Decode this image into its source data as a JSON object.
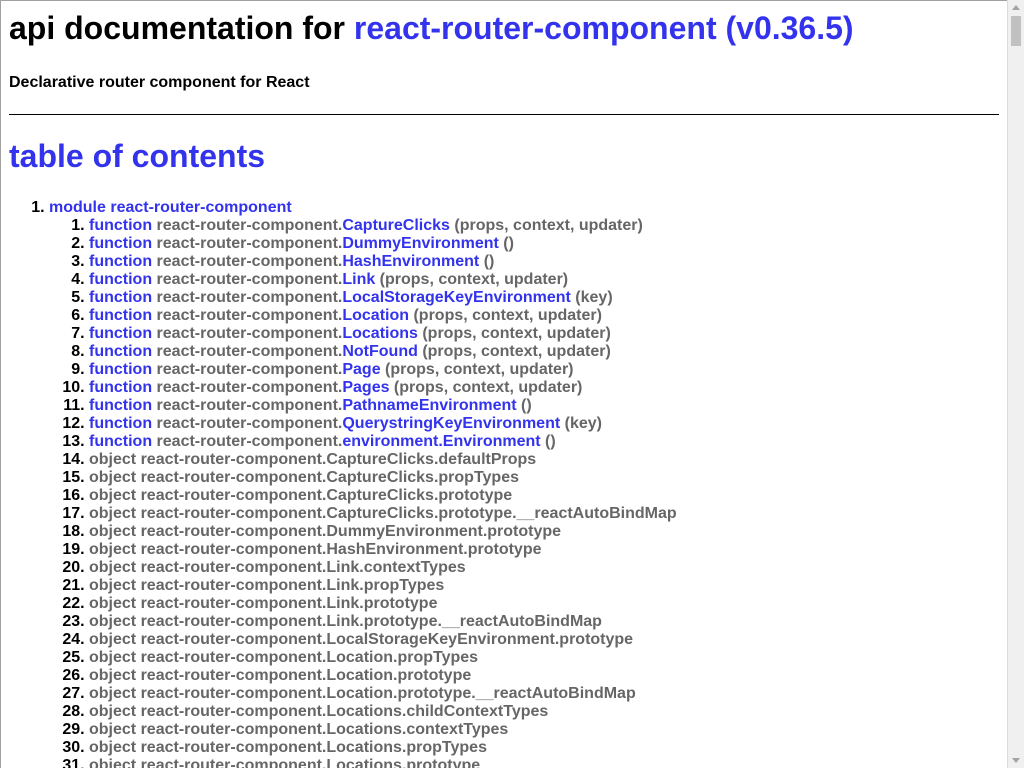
{
  "header": {
    "title_prefix": "api documentation for ",
    "title_package": "react-router-component (v0.36.5)",
    "description": "Declarative router component for React"
  },
  "toc": {
    "heading": "table of contents",
    "module_label": "module react-router-component",
    "items": [
      {
        "kind": "function",
        "ns": "react-router-component.",
        "name": "CaptureClicks",
        "args": " (props, context, updater)"
      },
      {
        "kind": "function",
        "ns": "react-router-component.",
        "name": "DummyEnvironment",
        "args": " ()"
      },
      {
        "kind": "function",
        "ns": "react-router-component.",
        "name": "HashEnvironment",
        "args": " ()"
      },
      {
        "kind": "function",
        "ns": "react-router-component.",
        "name": "Link",
        "args": " (props, context, updater)"
      },
      {
        "kind": "function",
        "ns": "react-router-component.",
        "name": "LocalStorageKeyEnvironment",
        "args": " (key)"
      },
      {
        "kind": "function",
        "ns": "react-router-component.",
        "name": "Location",
        "args": " (props, context, updater)"
      },
      {
        "kind": "function",
        "ns": "react-router-component.",
        "name": "Locations",
        "args": " (props, context, updater)"
      },
      {
        "kind": "function",
        "ns": "react-router-component.",
        "name": "NotFound",
        "args": " (props, context, updater)"
      },
      {
        "kind": "function",
        "ns": "react-router-component.",
        "name": "Page",
        "args": " (props, context, updater)"
      },
      {
        "kind": "function",
        "ns": "react-router-component.",
        "name": "Pages",
        "args": " (props, context, updater)"
      },
      {
        "kind": "function",
        "ns": "react-router-component.",
        "name": "PathnameEnvironment",
        "args": " ()"
      },
      {
        "kind": "function",
        "ns": "react-router-component.",
        "name": "QuerystringKeyEnvironment",
        "args": " (key)"
      },
      {
        "kind": "function",
        "ns": "react-router-component.",
        "name": "environment.Environment",
        "args": " ()"
      },
      {
        "kind": "object",
        "text": "object react-router-component.CaptureClicks.defaultProps"
      },
      {
        "kind": "object",
        "text": "object react-router-component.CaptureClicks.propTypes"
      },
      {
        "kind": "object",
        "text": "object react-router-component.CaptureClicks.prototype"
      },
      {
        "kind": "object",
        "text": "object react-router-component.CaptureClicks.prototype.__reactAutoBindMap"
      },
      {
        "kind": "object",
        "text": "object react-router-component.DummyEnvironment.prototype"
      },
      {
        "kind": "object",
        "text": "object react-router-component.HashEnvironment.prototype"
      },
      {
        "kind": "object",
        "text": "object react-router-component.Link.contextTypes"
      },
      {
        "kind": "object",
        "text": "object react-router-component.Link.propTypes"
      },
      {
        "kind": "object",
        "text": "object react-router-component.Link.prototype"
      },
      {
        "kind": "object",
        "text": "object react-router-component.Link.prototype.__reactAutoBindMap"
      },
      {
        "kind": "object",
        "text": "object react-router-component.LocalStorageKeyEnvironment.prototype"
      },
      {
        "kind": "object",
        "text": "object react-router-component.Location.propTypes"
      },
      {
        "kind": "object",
        "text": "object react-router-component.Location.prototype"
      },
      {
        "kind": "object",
        "text": "object react-router-component.Location.prototype.__reactAutoBindMap"
      },
      {
        "kind": "object",
        "text": "object react-router-component.Locations.childContextTypes"
      },
      {
        "kind": "object",
        "text": "object react-router-component.Locations.contextTypes"
      },
      {
        "kind": "object",
        "text": "object react-router-component.Locations.propTypes"
      },
      {
        "kind": "object",
        "text": "object react-router-component.Locations.prototype"
      }
    ]
  },
  "colors": {
    "link": "#3333ee",
    "muted": "#666666",
    "text": "#000000"
  }
}
